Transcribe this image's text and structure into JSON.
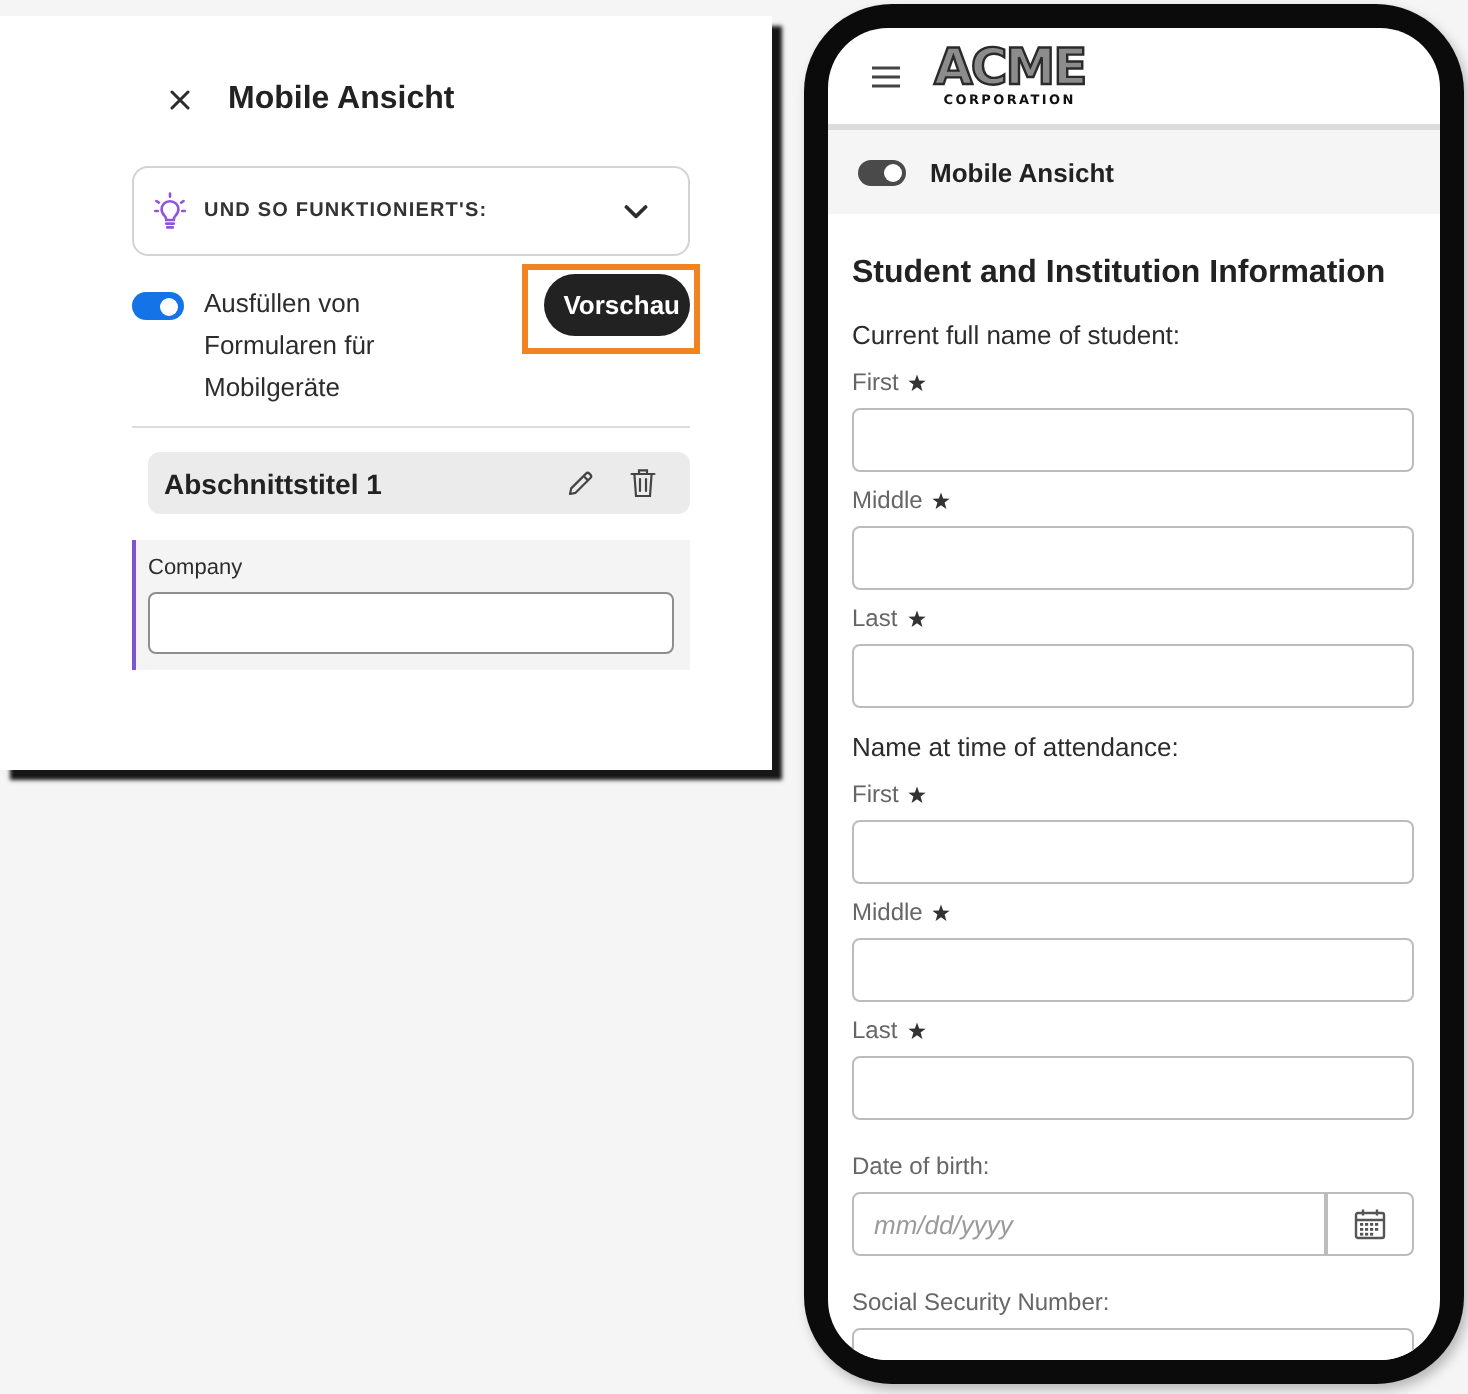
{
  "settings_panel": {
    "title": "Mobile Ansicht",
    "help_accordion": {
      "label": "UND SO FUNKTIONIERT'S:",
      "expanded": false
    },
    "mobile_form_toggle": {
      "label": "Ausfüllen von Formularen für Mobilgeräte",
      "on": true
    },
    "preview_button": {
      "label": "Vorschau",
      "highlighted": true
    },
    "section": {
      "title": "Abschnittstitel 1",
      "fields": [
        {
          "label": "Company"
        }
      ]
    }
  },
  "phone_preview": {
    "logo": {
      "wordmark": "ACME",
      "tagline": "CORPORATION"
    },
    "mobile_view_toggle": {
      "label": "Mobile Ansicht",
      "on": true
    },
    "form": {
      "title": "Student and Institution Information",
      "groups": [
        {
          "heading": "Current full name of student:",
          "fields": [
            {
              "kind": "text",
              "label": "First",
              "required": true
            },
            {
              "kind": "text",
              "label": "Middle",
              "required": true
            },
            {
              "kind": "text",
              "label": "Last",
              "required": true
            }
          ]
        },
        {
          "heading": "Name at time of attendance:",
          "fields": [
            {
              "kind": "text",
              "label": "First",
              "required": true
            },
            {
              "kind": "text",
              "label": "Middle",
              "required": true
            },
            {
              "kind": "text",
              "label": "Last",
              "required": true
            }
          ]
        },
        {
          "fields": [
            {
              "kind": "date",
              "label": "Date of birth:",
              "placeholder": "mm/dd/yyyy",
              "required": false
            }
          ]
        },
        {
          "fields": [
            {
              "kind": "text",
              "label": "Social Security Number:",
              "required": false
            }
          ]
        }
      ]
    }
  }
}
